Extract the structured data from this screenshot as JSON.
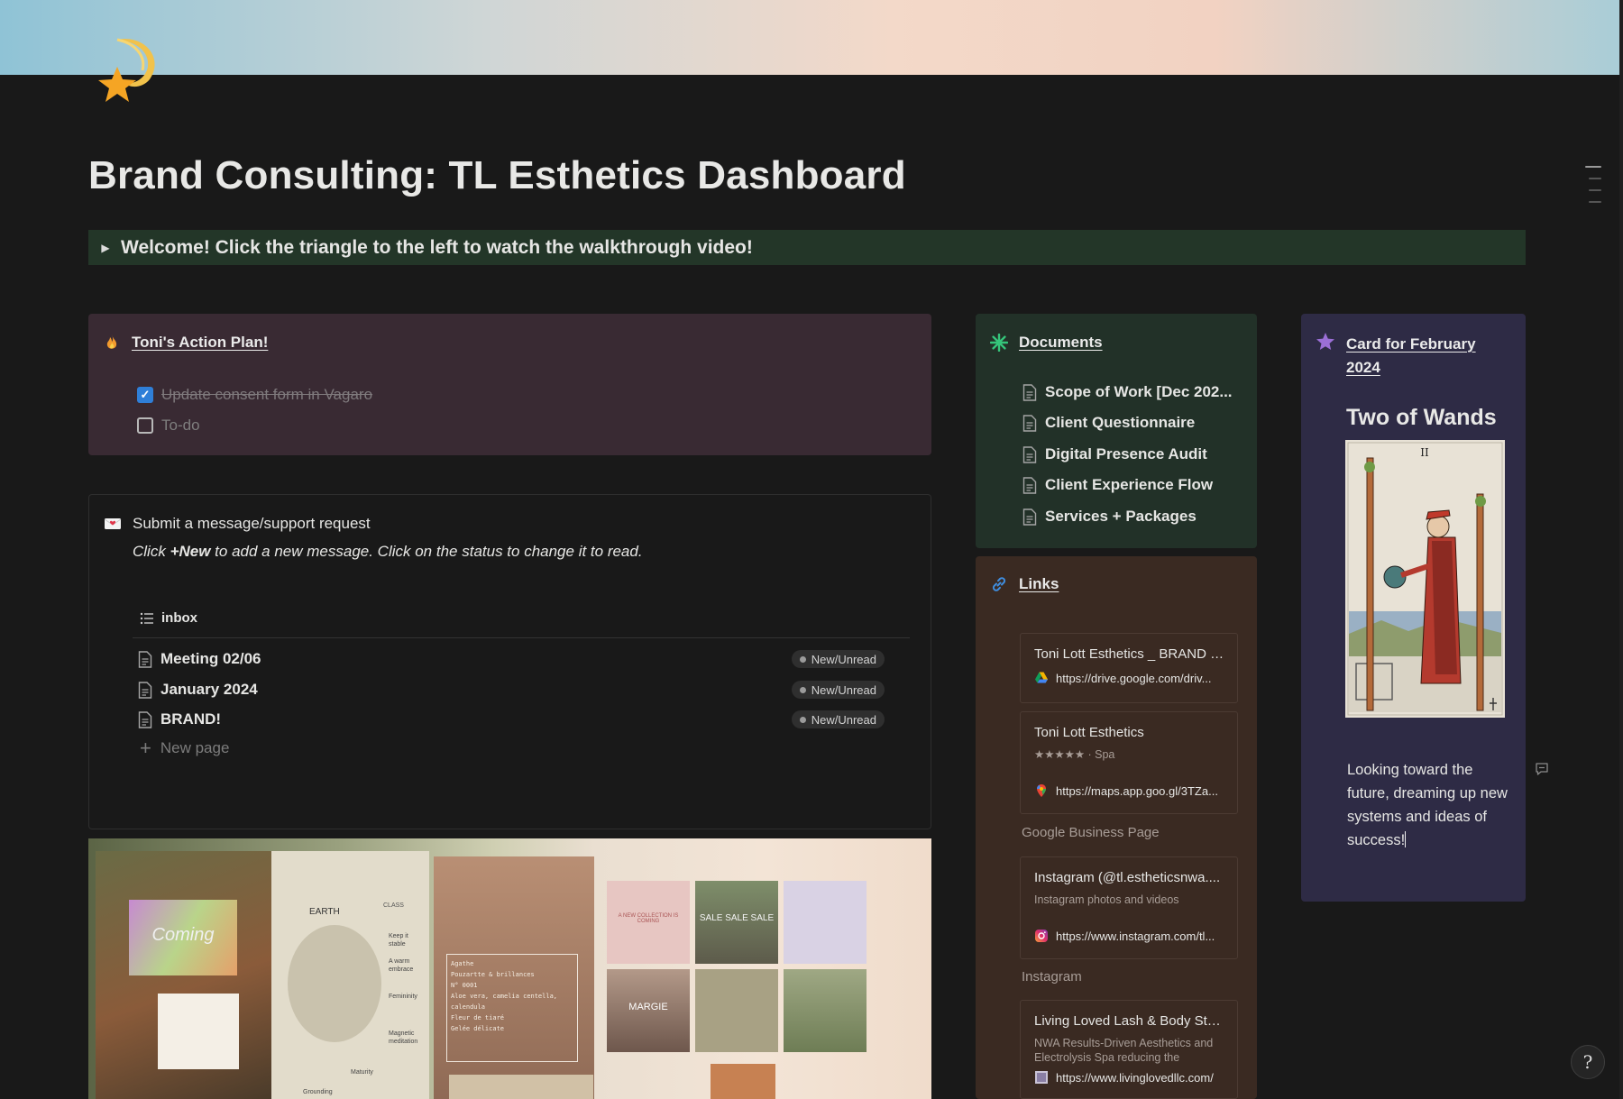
{
  "page": {
    "title": "Brand Consulting: TL Esthetics Dashboard",
    "icon": "shooting-star-icon"
  },
  "welcome": {
    "text": "Welcome! Click the triangle to the left to watch the walkthrough video!"
  },
  "action_plan": {
    "title": "Toni's Action Plan!",
    "icon": "fire-icon",
    "todos": [
      {
        "label": "Update consent form in Vagaro",
        "checked": true
      },
      {
        "label": "To-do",
        "checked": false
      }
    ]
  },
  "messages": {
    "icon": "love-letter-icon",
    "title": "Submit a message/support request",
    "subtitle_prefix": "Click ",
    "subtitle_bold": "+New",
    "subtitle_suffix": " to add a new message. Click on the status to change it to read.",
    "view_name": "inbox",
    "rows": [
      {
        "name": "Meeting 02/06",
        "status": "New/Unread"
      },
      {
        "name": "January 2024",
        "status": "New/Unread"
      },
      {
        "name": "BRAND!",
        "status": "New/Unread"
      }
    ],
    "new_page": "New page"
  },
  "moodboard": {
    "texts": [
      "Coming",
      "EARTH",
      "Keep it stable",
      "A warm embrace",
      "Femininity",
      "Magnetic meditation",
      "Maturity",
      "Grounding",
      "CLASS",
      "Agathe",
      "Pouzartte & brillances",
      "Aloe vera, camelia centella, calendula",
      "N° 0001",
      "Fleur de tiaré",
      "Gelée délicate",
      "A NEW COLLECTION IS COMING",
      "SALE SALE SALE",
      "MARGIE"
    ]
  },
  "documents": {
    "title": "Documents",
    "icon": "asterisk-icon",
    "items": [
      "Scope of Work [Dec 202...",
      "Client Questionnaire",
      "Digital Presence Audit",
      "Client Experience Flow",
      "Services + Packages"
    ]
  },
  "links": {
    "title": "Links",
    "icon": "link-icon",
    "cards": [
      {
        "title": "Toni Lott Esthetics _ BRAND - ...",
        "desc": "",
        "url": "https://drive.google.com/driv...",
        "favicon": "google-drive-icon",
        "caption": ""
      },
      {
        "title": "Toni Lott Esthetics",
        "desc": "★★★★★ · Spa",
        "url": "https://maps.app.goo.gl/3TZa...",
        "favicon": "google-maps-icon",
        "caption": "Google Business Page"
      },
      {
        "title": "Instagram (@tl.estheticsnwa....",
        "desc": "Instagram photos and videos",
        "url": "https://www.instagram.com/tl...",
        "favicon": "instagram-icon",
        "caption": "Instagram"
      },
      {
        "title": "Living Loved Lash & Body Stu...",
        "desc": "NWA Results-Driven Aesthetics and Electrolysis Spa reducing the",
        "url": "https://www.livinglovedllc.com/",
        "favicon": "website-icon",
        "caption": ""
      }
    ]
  },
  "card": {
    "title_line1": "Card for February",
    "title_line2": "2024",
    "icon": "star-icon",
    "card_name": "Two of Wands",
    "numeral": "II",
    "quote": "Looking toward the future, dreaming up new systems and ideas of success!"
  },
  "help": {
    "label": "?"
  },
  "colors": {
    "background": "#191919",
    "welcome_callout": "#233628",
    "action_panel": "#392a33",
    "documents_panel": "#223128",
    "links_panel": "#3a2a22",
    "card_panel": "#2e2b45",
    "checkbox_blue": "#2f7fd8"
  }
}
